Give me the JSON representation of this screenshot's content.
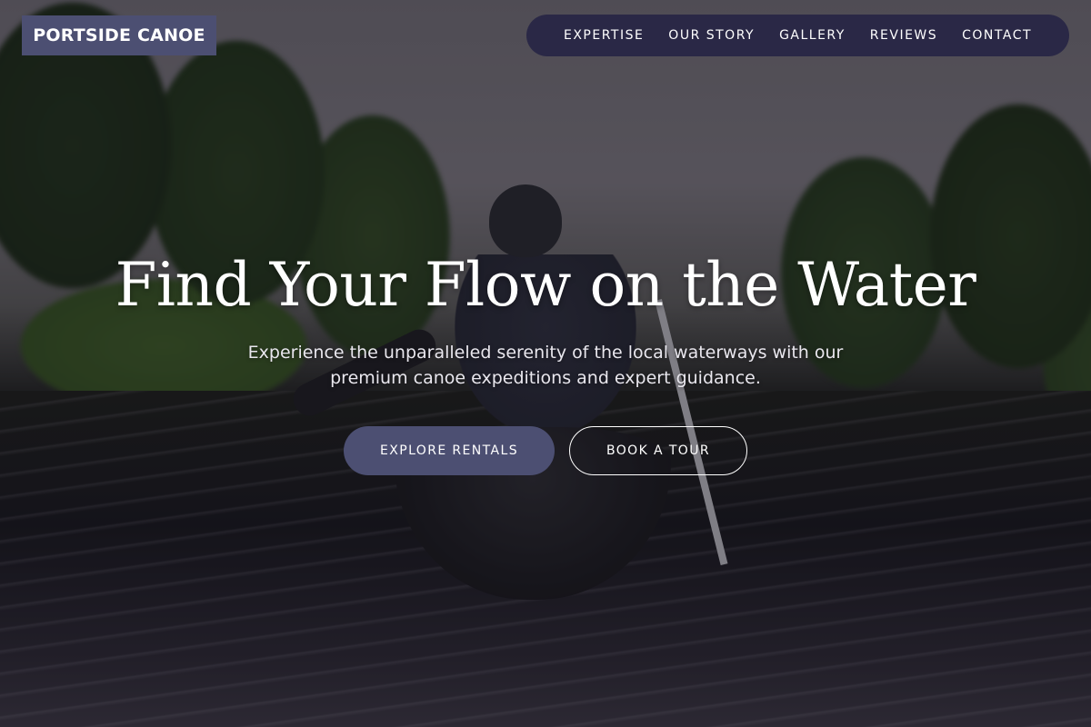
{
  "header": {
    "brand": "PORTSIDE CANOE",
    "nav": [
      {
        "label": "EXPERTISE"
      },
      {
        "label": "OUR STORY"
      },
      {
        "label": "GALLERY"
      },
      {
        "label": "REVIEWS"
      },
      {
        "label": "CONTACT"
      }
    ]
  },
  "hero": {
    "title": "Find Your Flow on the Water",
    "subtitle": "Experience the unparalleled serenity of the local waterways with our premium canoe expeditions and expert guidance.",
    "primary_cta": "EXPLORE RENTALS",
    "secondary_cta": "BOOK A TOUR"
  },
  "colors": {
    "brand_bg": "#4c4f72",
    "nav_bg": "#2a2846",
    "text": "#ffffff"
  }
}
